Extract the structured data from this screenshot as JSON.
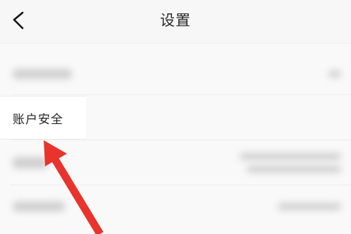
{
  "header": {
    "title": "设置",
    "back_icon": "chevron-left-icon"
  },
  "rows": [
    {
      "label": ""
    },
    {
      "label": "账户安全"
    },
    {
      "label": ""
    },
    {
      "label": ""
    }
  ],
  "annotation": {
    "type": "arrow",
    "color": "#e8342c"
  }
}
